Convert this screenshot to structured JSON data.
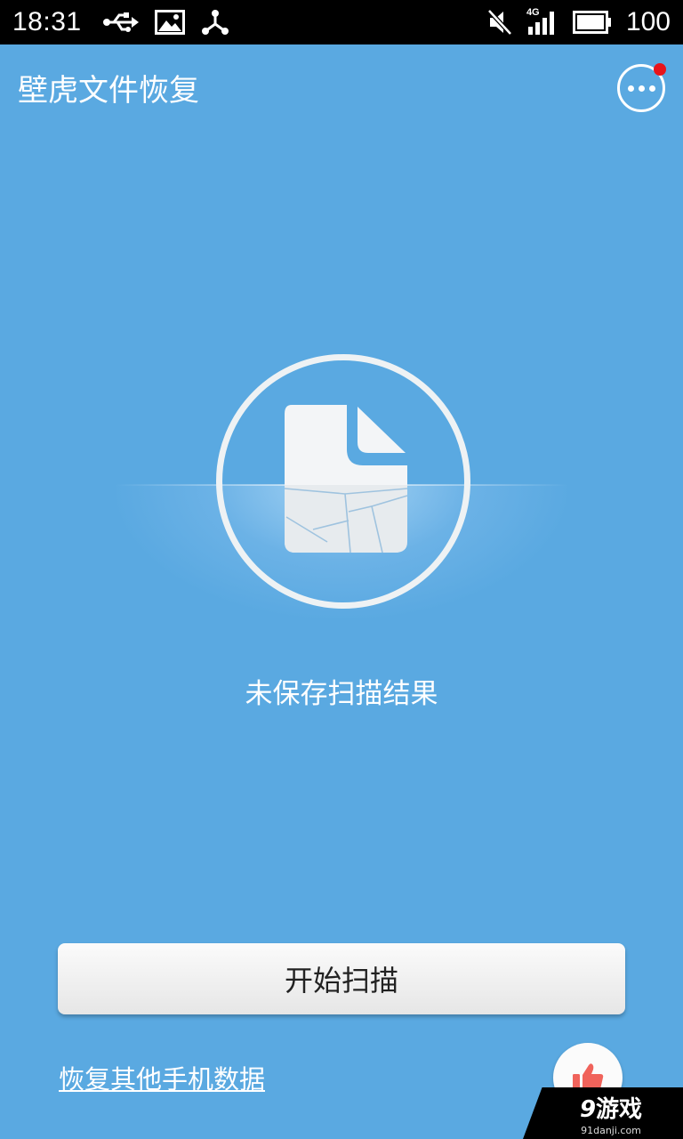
{
  "status_bar": {
    "time": "18:31",
    "left_icons": [
      "usb-icon",
      "image-icon",
      "share-hub-icon"
    ],
    "right_icons": [
      "mute-icon",
      "signal-4g-icon",
      "battery-icon"
    ],
    "network_label": "4G",
    "battery_level": "100"
  },
  "app_bar": {
    "title": "壁虎文件恢复",
    "menu_icon": "more-icon",
    "notification_dot_color": "#e8141b"
  },
  "main": {
    "hero_icon": "broken-document-icon",
    "status_text": "未保存扫描结果",
    "scan_button_label": "开始扫描",
    "recover_other_link": "恢复其他手机数据",
    "like_icon": "thumbs-up-icon"
  },
  "watermark": {
    "logo_num": "9",
    "logo_text": "游戏",
    "url": "91danji.com"
  },
  "colors": {
    "background": "#5aa9e1",
    "status_bar": "#000000",
    "button": "#f2f2f2",
    "like_icon": "#f0635b"
  }
}
